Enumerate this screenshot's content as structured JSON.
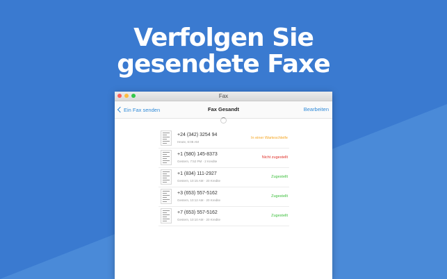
{
  "headline": {
    "line1": "Verfolgen Sie",
    "line2": "gesendete Faxe"
  },
  "window": {
    "title": "Fax"
  },
  "navbar": {
    "back_label": "Ein Fax senden",
    "title": "Fax Gesandt",
    "edit_label": "Bearbeiten"
  },
  "colors": {
    "background": "#3a7ad0",
    "accent": "#2f8ad8",
    "status_queue": "#f5a623",
    "status_failed": "#e0312a",
    "status_success": "#3cbf3c"
  },
  "faxes": [
    {
      "number": "+24 (342) 3254 94",
      "meta": "Heute, 6:08 AM",
      "status": "In einer Warteschleife",
      "status_color": "#f5a623"
    },
    {
      "number": "+1 (580) 145-8373",
      "meta": "Gestern, 7:52 PM · 2 Kredite",
      "status": "Nicht zugestellt",
      "status_color": "#e0312a"
    },
    {
      "number": "+1 (834) 111-2927",
      "meta": "Gestern, 10:15 AM · 20 Kredite",
      "status": "Zugestellt",
      "status_color": "#3cbf3c"
    },
    {
      "number": "+3 (653) 557-5162",
      "meta": "Gestern, 10:12 AM · 20 Kredite",
      "status": "Zugestellt",
      "status_color": "#3cbf3c"
    },
    {
      "number": "+7 (653) 557-5162",
      "meta": "Gestern, 10:10 AM · 20 Kredite",
      "status": "Zugestellt",
      "status_color": "#3cbf3c"
    }
  ]
}
